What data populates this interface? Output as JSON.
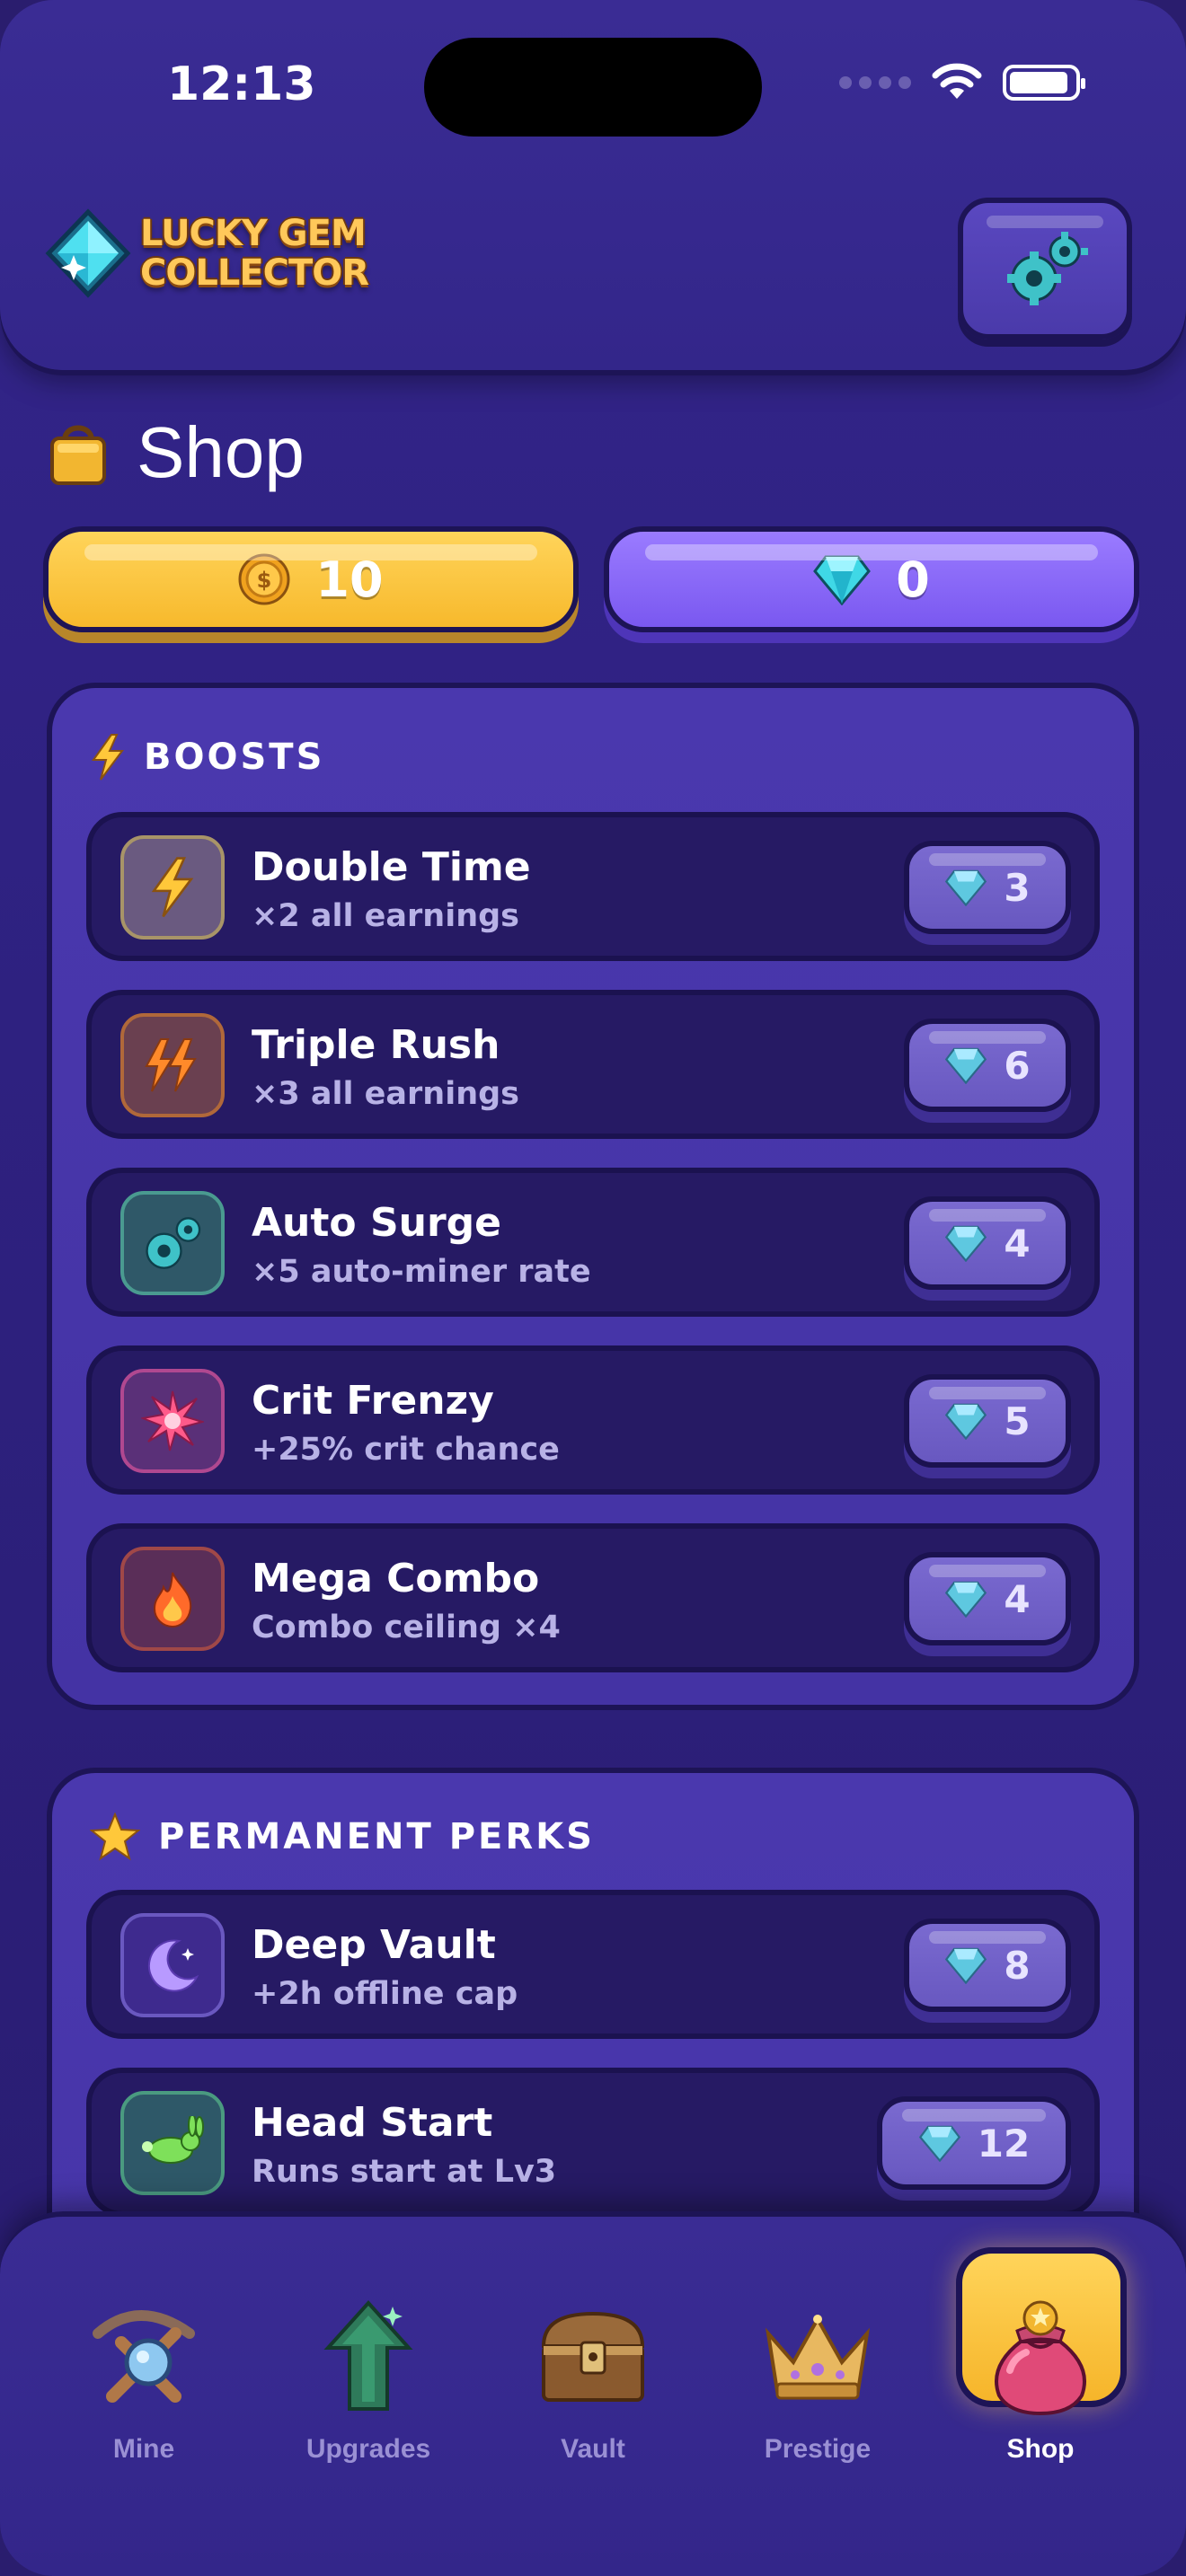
{
  "status": {
    "time": "12:13"
  },
  "app": {
    "logo_line1": "LUCKY GEM",
    "logo_line2": "COLLECTOR"
  },
  "page": {
    "title": "Shop"
  },
  "currency": {
    "coins": "10",
    "gems": "0"
  },
  "boosts": {
    "title": "BOOSTS",
    "items": [
      {
        "name": "Double Time",
        "desc": "×2 all earnings",
        "price": "3",
        "icon": "lightning-icon"
      },
      {
        "name": "Triple Rush",
        "desc": "×3 all earnings",
        "price": "6",
        "icon": "double-lightning-icon"
      },
      {
        "name": "Auto Surge",
        "desc": "×5 auto-miner rate",
        "price": "4",
        "icon": "gears-icon"
      },
      {
        "name": "Crit Frenzy",
        "desc": "+25% crit chance",
        "price": "5",
        "icon": "burst-icon"
      },
      {
        "name": "Mega Combo",
        "desc": "Combo ceiling ×4",
        "price": "4",
        "icon": "flame-icon"
      }
    ]
  },
  "perks": {
    "title": "PERMANENT PERKS",
    "items": [
      {
        "name": "Deep Vault",
        "desc": "+2h offline cap",
        "price": "8",
        "icon": "moon-icon"
      },
      {
        "name": "Head Start",
        "desc": "Runs start at Lv3",
        "price": "12",
        "icon": "rabbit-icon"
      }
    ]
  },
  "nav": {
    "tabs": [
      {
        "label": "Mine",
        "icon": "pickaxe-icon"
      },
      {
        "label": "Upgrades",
        "icon": "upgrade-arrow-icon"
      },
      {
        "label": "Vault",
        "icon": "chest-icon"
      },
      {
        "label": "Prestige",
        "icon": "crown-icon"
      },
      {
        "label": "Shop",
        "icon": "pouch-icon",
        "active": true
      }
    ]
  },
  "colors": {
    "coin_pill": "#f7b92c",
    "gem_pill": "#7a58f0",
    "background": "#2e2180"
  }
}
